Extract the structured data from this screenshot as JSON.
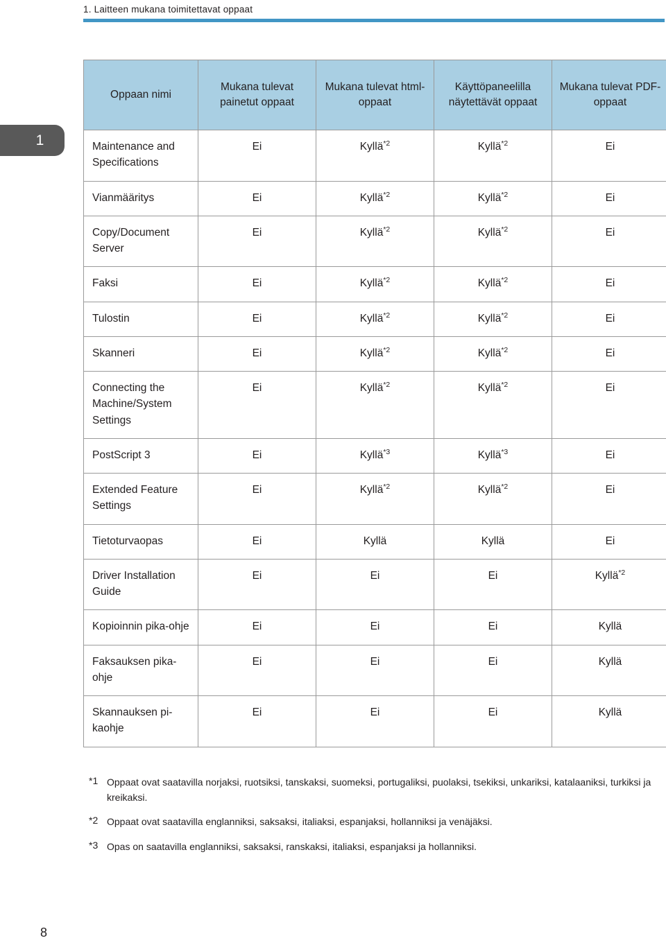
{
  "header": {
    "running_title": "1. Laitteen mukana toimitettavat oppaat",
    "rule_color": "#4296c5"
  },
  "chapter_tab": {
    "number": "1",
    "background_color": "#595959"
  },
  "table": {
    "header_background": "#a9cfe3",
    "border_color": "#9a9a9a",
    "columns": [
      "Oppaan nimi",
      "Mukana tulevat painetut oppaat",
      "Mukana tulevat html-oppaat",
      "Käyttöpaneelilla näytettävät oppaat",
      "Mukana tulevat PDF-oppaat"
    ],
    "rows": [
      {
        "name": "Maintenance and Specifications",
        "values": [
          {
            "text": "Ei",
            "sup": ""
          },
          {
            "text": "Kyllä",
            "sup": "*2"
          },
          {
            "text": "Kyllä",
            "sup": "*2"
          },
          {
            "text": "Ei",
            "sup": ""
          }
        ]
      },
      {
        "name": "Vianmääritys",
        "values": [
          {
            "text": "Ei",
            "sup": ""
          },
          {
            "text": "Kyllä",
            "sup": "*2"
          },
          {
            "text": "Kyllä",
            "sup": "*2"
          },
          {
            "text": "Ei",
            "sup": ""
          }
        ]
      },
      {
        "name": "Copy/Document Server",
        "values": [
          {
            "text": "Ei",
            "sup": ""
          },
          {
            "text": "Kyllä",
            "sup": "*2"
          },
          {
            "text": "Kyllä",
            "sup": "*2"
          },
          {
            "text": "Ei",
            "sup": ""
          }
        ]
      },
      {
        "name": "Faksi",
        "values": [
          {
            "text": "Ei",
            "sup": ""
          },
          {
            "text": "Kyllä",
            "sup": "*2"
          },
          {
            "text": "Kyllä",
            "sup": "*2"
          },
          {
            "text": "Ei",
            "sup": ""
          }
        ]
      },
      {
        "name": "Tulostin",
        "values": [
          {
            "text": "Ei",
            "sup": ""
          },
          {
            "text": "Kyllä",
            "sup": "*2"
          },
          {
            "text": "Kyllä",
            "sup": "*2"
          },
          {
            "text": "Ei",
            "sup": ""
          }
        ]
      },
      {
        "name": "Skanneri",
        "values": [
          {
            "text": "Ei",
            "sup": ""
          },
          {
            "text": "Kyllä",
            "sup": "*2"
          },
          {
            "text": "Kyllä",
            "sup": "*2"
          },
          {
            "text": "Ei",
            "sup": ""
          }
        ]
      },
      {
        "name": "Connecting the Machine/System Settings",
        "values": [
          {
            "text": "Ei",
            "sup": ""
          },
          {
            "text": "Kyllä",
            "sup": "*2"
          },
          {
            "text": "Kyllä",
            "sup": "*2"
          },
          {
            "text": "Ei",
            "sup": ""
          }
        ]
      },
      {
        "name": "PostScript 3",
        "values": [
          {
            "text": "Ei",
            "sup": ""
          },
          {
            "text": "Kyllä",
            "sup": "*3"
          },
          {
            "text": "Kyllä",
            "sup": "*3"
          },
          {
            "text": "Ei",
            "sup": ""
          }
        ]
      },
      {
        "name": "Extended Feature Settings",
        "values": [
          {
            "text": "Ei",
            "sup": ""
          },
          {
            "text": "Kyllä",
            "sup": "*2"
          },
          {
            "text": "Kyllä",
            "sup": "*2"
          },
          {
            "text": "Ei",
            "sup": ""
          }
        ]
      },
      {
        "name": "Tietoturvaopas",
        "values": [
          {
            "text": "Ei",
            "sup": ""
          },
          {
            "text": "Kyllä",
            "sup": ""
          },
          {
            "text": "Kyllä",
            "sup": ""
          },
          {
            "text": "Ei",
            "sup": ""
          }
        ]
      },
      {
        "name": "Driver Installation Guide",
        "values": [
          {
            "text": "Ei",
            "sup": ""
          },
          {
            "text": "Ei",
            "sup": ""
          },
          {
            "text": "Ei",
            "sup": ""
          },
          {
            "text": "Kyllä",
            "sup": "*2"
          }
        ]
      },
      {
        "name": "Kopioinnin pika-ohje",
        "values": [
          {
            "text": "Ei",
            "sup": ""
          },
          {
            "text": "Ei",
            "sup": ""
          },
          {
            "text": "Ei",
            "sup": ""
          },
          {
            "text": "Kyllä",
            "sup": ""
          }
        ]
      },
      {
        "name": "Faksauksen pika-ohje",
        "values": [
          {
            "text": "Ei",
            "sup": ""
          },
          {
            "text": "Ei",
            "sup": ""
          },
          {
            "text": "Ei",
            "sup": ""
          },
          {
            "text": "Kyllä",
            "sup": ""
          }
        ]
      },
      {
        "name": "Skannauksen pi-kaohje",
        "values": [
          {
            "text": "Ei",
            "sup": ""
          },
          {
            "text": "Ei",
            "sup": ""
          },
          {
            "text": "Ei",
            "sup": ""
          },
          {
            "text": "Kyllä",
            "sup": ""
          }
        ]
      }
    ]
  },
  "footnotes": [
    {
      "mark": "*1",
      "text": "Oppaat ovat saatavilla norjaksi, ruotsiksi, tanskaksi, suomeksi, portugaliksi, puolaksi, tsekiksi, unkariksi, katalaaniksi, turkiksi ja kreikaksi."
    },
    {
      "mark": "*2",
      "text": "Oppaat ovat saatavilla englanniksi, saksaksi, italiaksi, espanjaksi, hollanniksi ja venäjäksi."
    },
    {
      "mark": "*3",
      "text": "Opas on saatavilla englanniksi, saksaksi, ranskaksi, italiaksi, espanjaksi ja hollanniksi."
    }
  ],
  "folio": "8"
}
